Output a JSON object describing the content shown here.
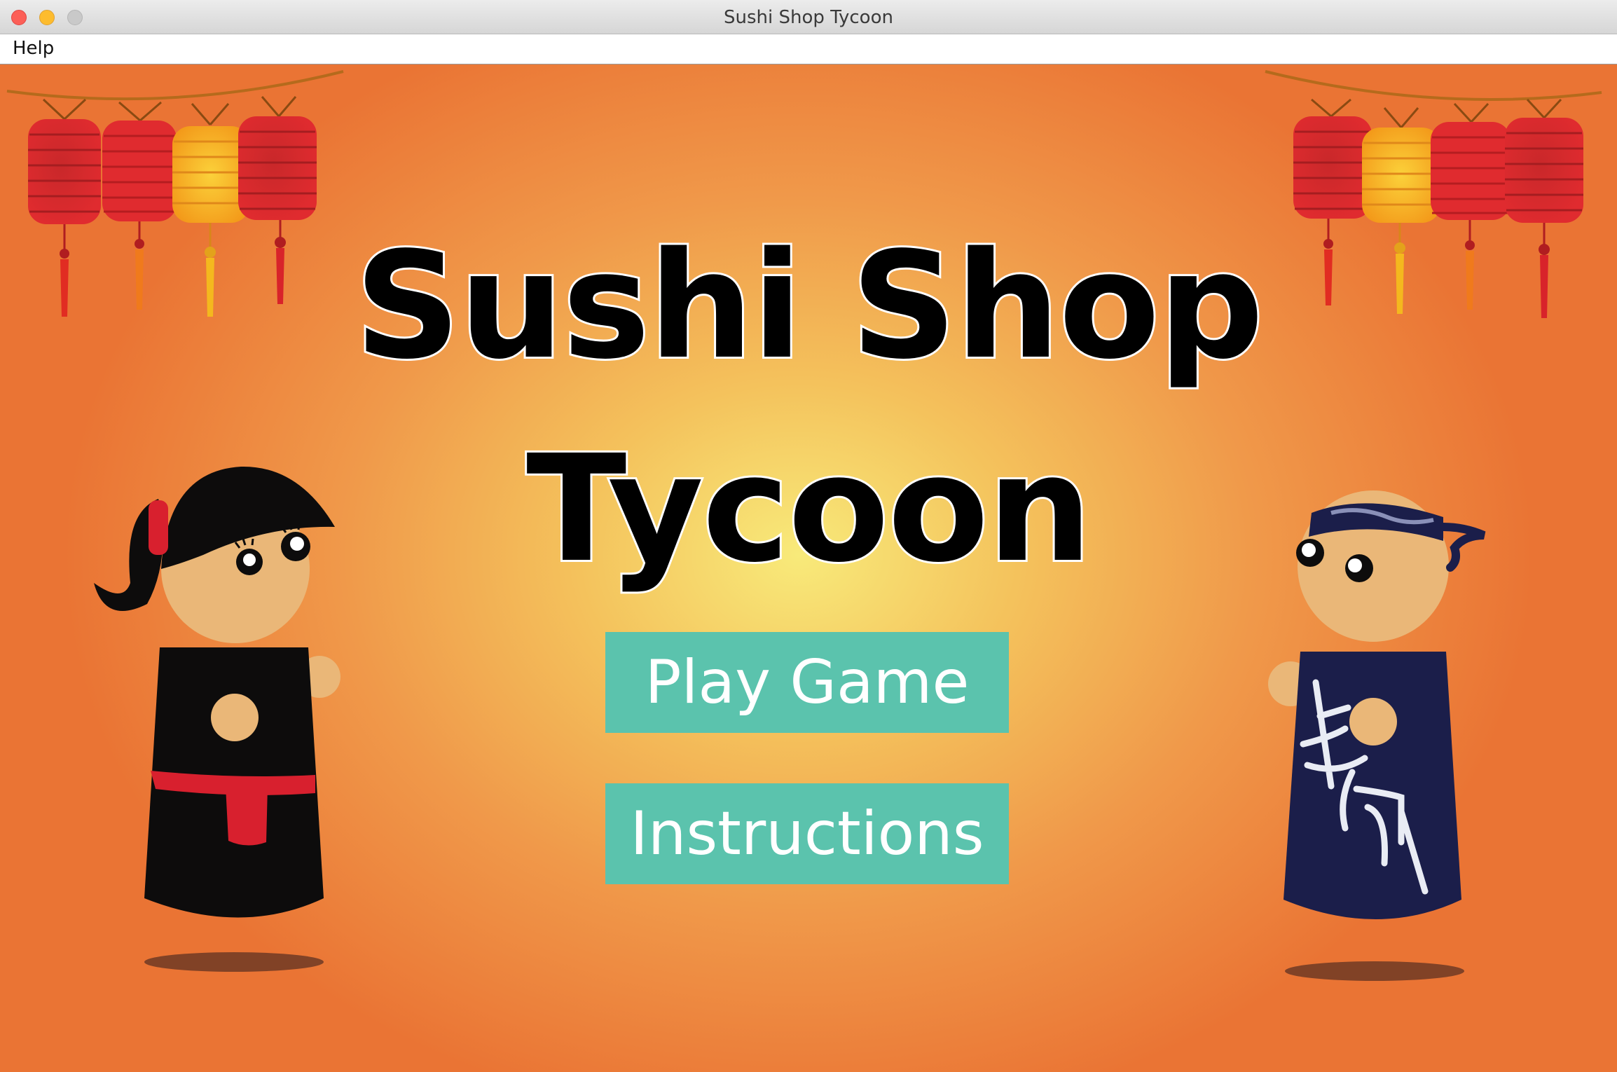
{
  "window": {
    "title": "Sushi Shop Tycoon"
  },
  "menubar": {
    "items": [
      {
        "label": "Help"
      }
    ]
  },
  "game": {
    "title_line1": "Sushi Shop",
    "title_line2": "Tycoon",
    "buttons": {
      "play": "Play Game",
      "instructions": "Instructions"
    }
  },
  "colors": {
    "button": "#5bc3ad",
    "background_center": "#f8ea7a",
    "background_edge": "#ea7434",
    "lantern_red": "#d8232a",
    "lantern_yellow": "#f7a81b",
    "chef_apron": "#1b1e4a"
  }
}
